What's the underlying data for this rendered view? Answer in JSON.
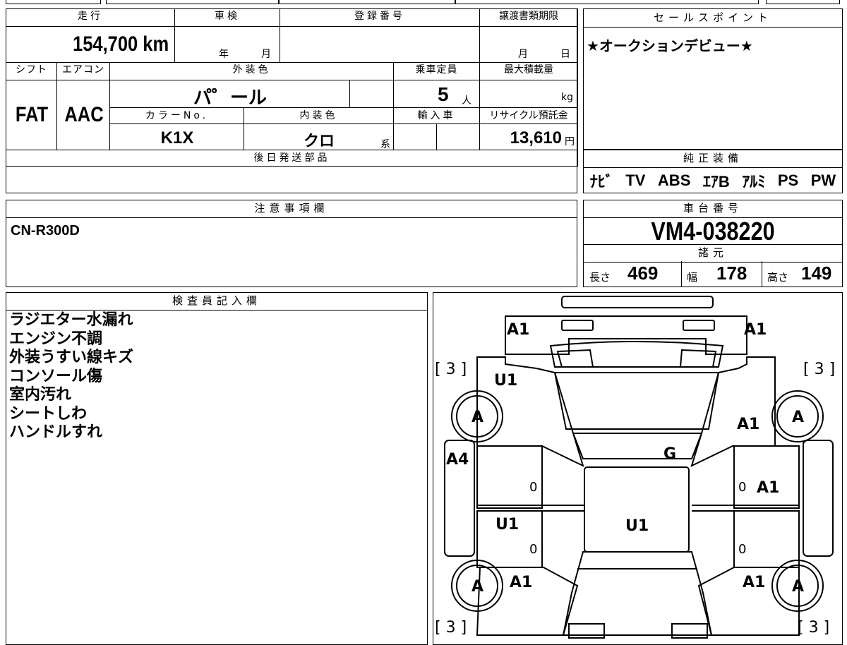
{
  "top_table": {
    "mileage_label": "走行",
    "mileage_value": "154,700 km",
    "inspection_label": "車検",
    "inspection_year": "年",
    "inspection_month": "月",
    "registration_label": "登録番号",
    "transfer_deadline_label": "譲渡書類期限",
    "transfer_month": "月",
    "transfer_day": "日",
    "shift_label": "シフト",
    "shift_value": "FAT",
    "aircon_label": "エアコン",
    "aircon_value": "AAC",
    "exterior_color_label": "外装色",
    "exterior_color_value": "パ゜ール",
    "capacity_label": "乗車定員",
    "capacity_value": "5",
    "capacity_unit": "人",
    "max_load_label": "最大積載量",
    "max_load_unit": "kg",
    "color_no_label": "カラーNo.",
    "color_no_value": "K1X",
    "interior_color_label": "内装色",
    "interior_color_value": "クロ",
    "interior_color_suffix": "系",
    "import_label": "輸入車",
    "recycle_label": "リサイクル預託金",
    "recycle_value": "13,610",
    "recycle_unit": "円",
    "later_parts_label": "後日発送部品"
  },
  "sales_point": {
    "label": "セールスポイント",
    "text": "★オークションデビュー★"
  },
  "genuine_equipment": {
    "label": "純正装備",
    "items": [
      "ﾅﾋﾞ",
      "TV",
      "ABS",
      "ｴｱB",
      "ｱﾙﾐ",
      "PS",
      "PW"
    ]
  },
  "notes": {
    "label": "注意事項欄",
    "text": "CN-R300D"
  },
  "chassis": {
    "label": "車台番号",
    "value": "VM4-038220",
    "specs_label": "諸元",
    "length_label": "長さ",
    "length_value": "469",
    "width_label": "幅",
    "width_value": "178",
    "height_label": "高さ",
    "height_value": "149"
  },
  "inspector": {
    "label": "検査員記入欄",
    "items": [
      "ラジエター水漏れ",
      "エンジン不調",
      "外装うすい線キズ",
      "コンソール傷",
      "室内汚れ",
      "シートしわ",
      "ハンドルすれ"
    ]
  },
  "diagram": {
    "marks": {
      "front_left": "A1",
      "front_right": "A1",
      "tire_fl": "[ 3 ]",
      "tire_fr": "[ 3 ]",
      "tire_rl": "[ 3 ]",
      "tire_rr": "[ 3 ]",
      "hood": "U1",
      "fender_fr": "A1",
      "wheel_fl": "A",
      "wheel_fr": "A",
      "wheel_rl": "A",
      "wheel_rr": "A",
      "windshield": "G",
      "pillar_left": "A4",
      "door_fr": "A1",
      "door_rl": "U1",
      "roof": "U1",
      "qtr_rl": "A1",
      "qtr_rr": "A1",
      "zero_1": "0",
      "zero_2": "0",
      "zero_3": "0",
      "zero_4": "0"
    }
  }
}
